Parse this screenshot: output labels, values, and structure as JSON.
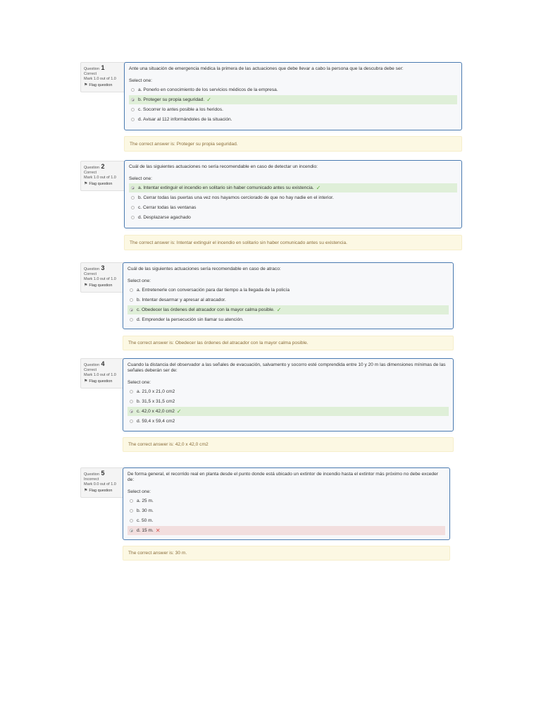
{
  "labels": {
    "question": "Question",
    "select_one": "Select one:",
    "flag": "Flag question",
    "answer_prefix": "The correct answer is: "
  },
  "questions": [
    {
      "number": "1",
      "status": "Correct",
      "mark": "Mark 1.0 out of 1.0",
      "text": "Ante una situación de emergencia médica la primera de las actuaciones que debe llevar a cabo la persona que la descubra debe ser:",
      "options": [
        {
          "label": "a. Ponerlo en conocimiento de los servicios médicos de la empresa.",
          "state": ""
        },
        {
          "label": "b. Proteger su propia seguridad.",
          "state": "correct"
        },
        {
          "label": "c. Socorrer lo antes posible a los heridos.",
          "state": ""
        },
        {
          "label": "d. Avisar al 112 informándoles de la situación.",
          "state": ""
        }
      ],
      "correct_answer": "Proteger su propia seguridad."
    },
    {
      "number": "2",
      "status": "Correct",
      "mark": "Mark 1.0 out of 1.0",
      "text": "Cuál de las siguientes actuaciones no sería recomendable en caso de detectar un incendio:",
      "options": [
        {
          "label": "a. Intentar extinguir el incendio en solitario sin haber comunicado antes su existencia.",
          "state": "correct"
        },
        {
          "label": "b. Cerrar todas las puertas una vez nos hayamos cerciorado de que no hay nadie en el interior.",
          "state": ""
        },
        {
          "label": "c. Cerrar todas las ventanas",
          "state": ""
        },
        {
          "label": "d. Desplazarse agachado",
          "state": ""
        }
      ],
      "correct_answer": "Intentar extinguir el incendio en solitario sin haber comunicado antes su existencia."
    },
    {
      "number": "3",
      "status": "Correct",
      "mark": "Mark 1.0 out of 1.0",
      "text": "Cuál de las siguientes actuaciones sería recomendable en caso de atraco:",
      "options": [
        {
          "label": "a. Entretenerle con conversación para dar tiempo a la llegada de la policía",
          "state": ""
        },
        {
          "label": "b. Intentar desarmar y apresar al atracador.",
          "state": ""
        },
        {
          "label": "c. Obedecer las órdenes del atracador con la mayor calma posible.",
          "state": "correct"
        },
        {
          "label": "d. Emprender la persecución sin llamar su atención.",
          "state": ""
        }
      ],
      "correct_answer": "Obedecer las órdenes del atracador con la mayor calma posible."
    },
    {
      "number": "4",
      "status": "Correct",
      "mark": "Mark 1.0 out of 1.0",
      "text": "Cuando la distancia del observador a las señales de evacuación, salvamento y socorro esté comprendida entre 10 y 20 m las dimensiones mínimas de las señales deberán ser de:",
      "options": [
        {
          "label": "a. 21,0 x 21,0 cm2",
          "state": ""
        },
        {
          "label": "b. 31,5 x 31,5 cm2",
          "state": ""
        },
        {
          "label": "c. 42,0 x 42,0 cm2",
          "state": "correct"
        },
        {
          "label": "d. 59,4 x 59,4 cm2",
          "state": ""
        }
      ],
      "correct_answer": "42,0 x 42,0 cm2"
    },
    {
      "number": "5",
      "status": "Incorrect",
      "mark": "Mark 0.0 out of 1.0",
      "text": "De forma general, el recorrido real en planta desde el punto donde está ubicado un extintor de incendio hasta el extintor más próximo no debe exceder de:",
      "options": [
        {
          "label": "a. 25 m.",
          "state": ""
        },
        {
          "label": "b. 30 m.",
          "state": ""
        },
        {
          "label": "c. 50 m.",
          "state": ""
        },
        {
          "label": "d. 15 m.",
          "state": "incorrect"
        }
      ],
      "correct_answer": "30 m."
    }
  ],
  "colors": {
    "box_border": "#4a7ab0",
    "correct_bg": "#dfefd8",
    "incorrect_bg": "#f2dede",
    "feedback_bg": "#fcf8e3",
    "check": "#5ba63a",
    "cross": "#d9534f"
  },
  "icons": {
    "correct": "check-icon",
    "incorrect": "cross-icon",
    "flag": "flag-icon"
  }
}
